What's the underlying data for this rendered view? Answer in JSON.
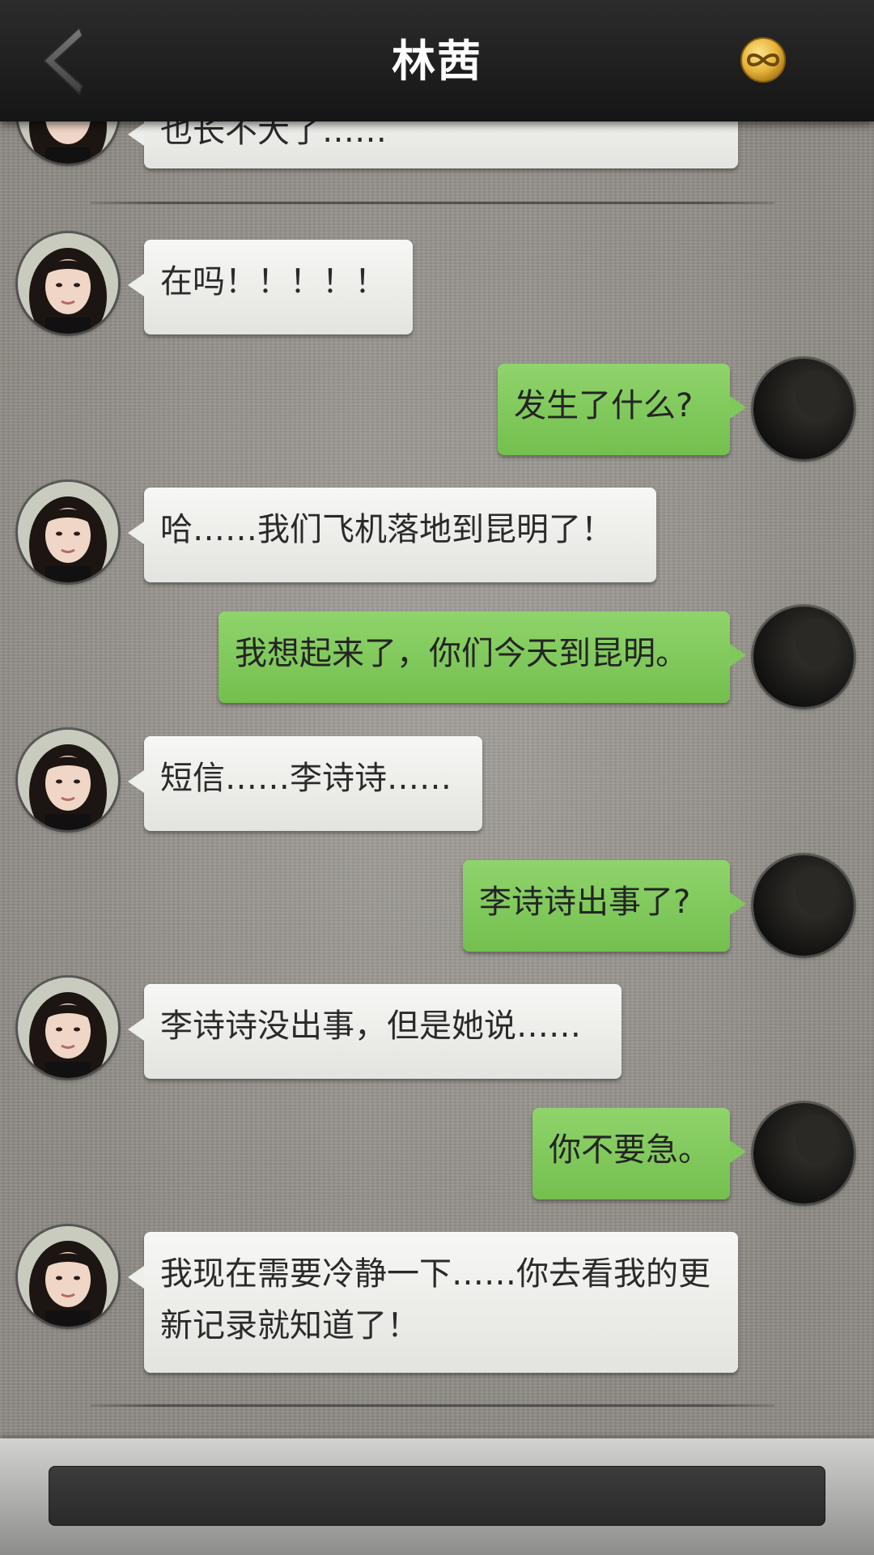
{
  "header": {
    "title": "林茜",
    "back_icon": "chevron-left-icon",
    "action_icon": "infinity-coin-icon",
    "accent": "#e6b33a"
  },
  "messages": [
    {
      "sender": "contact",
      "text": "也长不大了……"
    },
    {
      "sender": "contact",
      "text": "在吗！！！！！"
    },
    {
      "sender": "me",
      "text": "发生了什么?"
    },
    {
      "sender": "contact",
      "text": "哈……我们飞机落地到昆明了！"
    },
    {
      "sender": "me",
      "text": "我想起来了，你们今天到昆明。"
    },
    {
      "sender": "contact",
      "text": "短信……李诗诗……"
    },
    {
      "sender": "me",
      "text": "李诗诗出事了?"
    },
    {
      "sender": "contact",
      "text": "李诗诗没出事，但是她说……"
    },
    {
      "sender": "me",
      "text": "你不要急。"
    },
    {
      "sender": "contact",
      "text": "我现在需要冷静一下……你去看我的更新记录就知道了！"
    }
  ],
  "input": {
    "value": "",
    "placeholder": ""
  },
  "colors": {
    "incoming_bubble": "#eeeeeb",
    "outgoing_bubble": "#7fc85a",
    "header_bg": "#1e1e1e",
    "input_bg": "#333333"
  }
}
